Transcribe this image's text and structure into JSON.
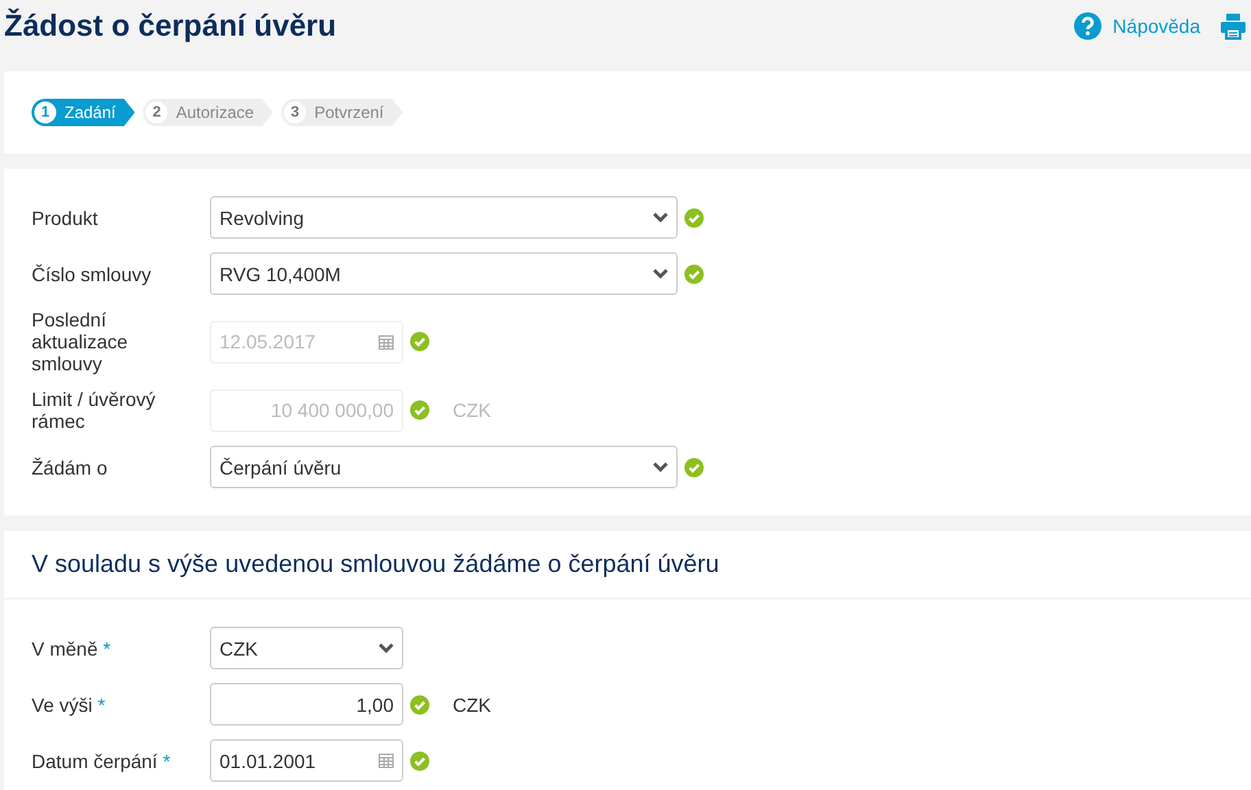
{
  "header": {
    "title": "Žádost o čerpání úvěru",
    "help_link": "Nápověda"
  },
  "steps": [
    {
      "number": "1",
      "label": "Zadání",
      "selected": true
    },
    {
      "number": "2",
      "label": "Autorizace",
      "selected": false
    },
    {
      "number": "3",
      "label": "Potvrzení",
      "selected": false
    }
  ],
  "contract_form": {
    "rows": [
      {
        "kind": "select",
        "label": "Produkt",
        "value": "Revolving",
        "disabled": false,
        "valid": true
      },
      {
        "kind": "select",
        "label": "Číslo smlouvy",
        "value": "RVG 10,400M",
        "disabled": false,
        "valid": true
      },
      {
        "kind": "date",
        "label": "Poslední aktualizace smlouvy",
        "value": "12.05.2017",
        "disabled": true,
        "valid": true
      },
      {
        "kind": "amount",
        "label": "Limit / úvěrový rámec",
        "value": "10 400 000,00",
        "unit": "CZK",
        "disabled": true,
        "valid": true
      },
      {
        "kind": "select",
        "label": "Žádám o",
        "value": "Čerpání úvěru",
        "disabled": false,
        "valid": true
      }
    ]
  },
  "drawdown_form": {
    "heading": "V souladu s výše uvedenou smlouvou žádáme o čerpání úvěru",
    "rows": [
      {
        "kind": "short-select",
        "label": "V měně",
        "required_mark": "*",
        "value": "CZK",
        "disabled": false,
        "valid": false
      },
      {
        "kind": "amount",
        "label": "Ve výši",
        "required_mark": "*",
        "value": "1,00",
        "unit": "CZK",
        "disabled": false,
        "valid": true
      },
      {
        "kind": "date",
        "label": "Datum čerpání",
        "required_mark": "*",
        "value": "01.01.2001",
        "disabled": false,
        "valid": true
      }
    ]
  }
}
